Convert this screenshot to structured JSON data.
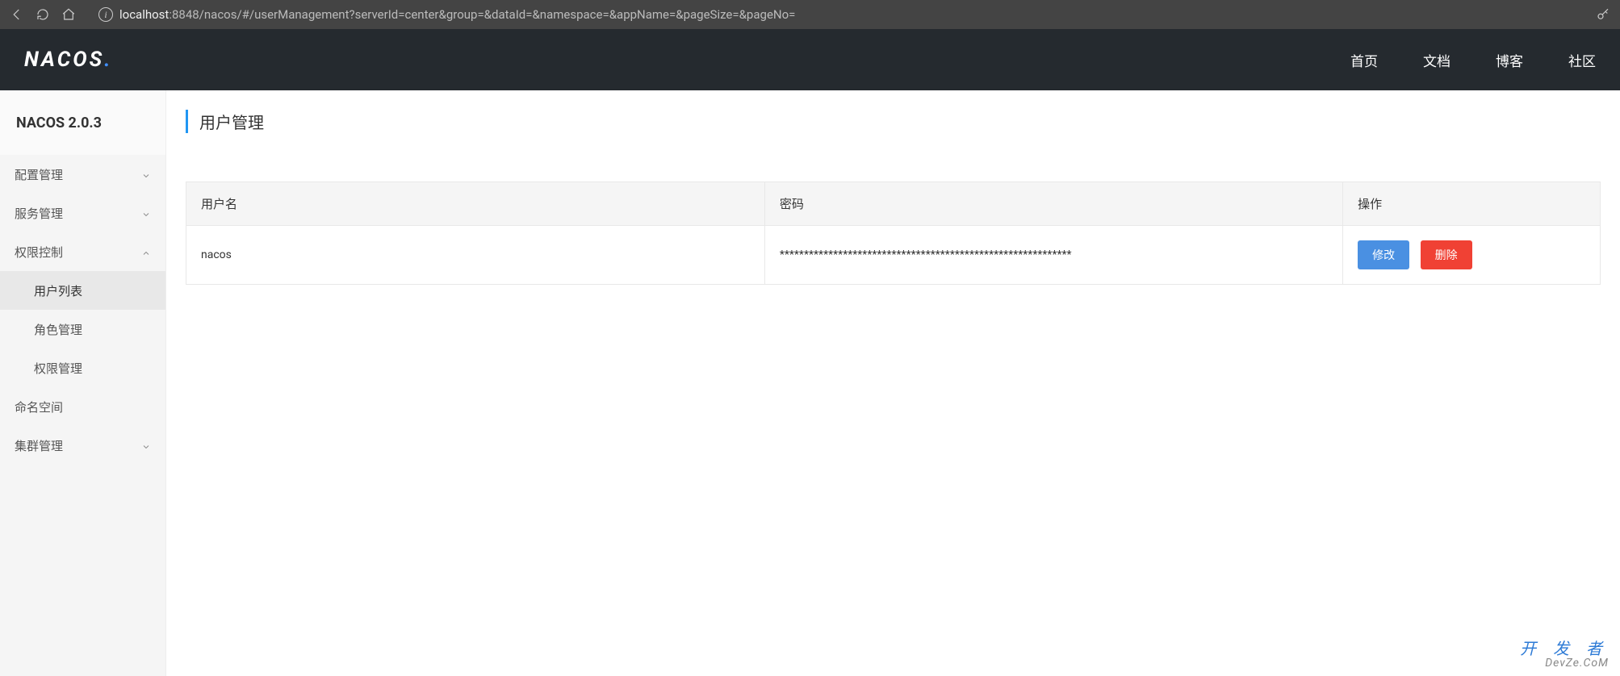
{
  "browser": {
    "url_host": "localhost",
    "url_rest": ":8848/nacos/#/userManagement?serverId=center&group=&dataId=&namespace=&appName=&pageSize=&pageNo="
  },
  "header": {
    "logo_text": "NACOS",
    "nav": {
      "home": "首页",
      "docs": "文档",
      "blog": "博客",
      "community": "社区"
    }
  },
  "sidebar": {
    "title": "NACOS 2.0.3",
    "menu": {
      "config": "配置管理",
      "service": "服务管理",
      "auth": "权限控制",
      "auth_children": {
        "users": "用户列表",
        "roles": "角色管理",
        "perms": "权限管理"
      },
      "namespace": "命名空间",
      "cluster": "集群管理"
    }
  },
  "page": {
    "title": "用户管理",
    "columns": {
      "username": "用户名",
      "password": "密码",
      "operation": "操作"
    },
    "rows": [
      {
        "username": "nacos",
        "password": "************************************************************"
      }
    ],
    "buttons": {
      "edit": "修改",
      "delete": "删除"
    }
  },
  "watermark": {
    "line1": "开 发 者",
    "line2": "DevZe.CoM"
  }
}
